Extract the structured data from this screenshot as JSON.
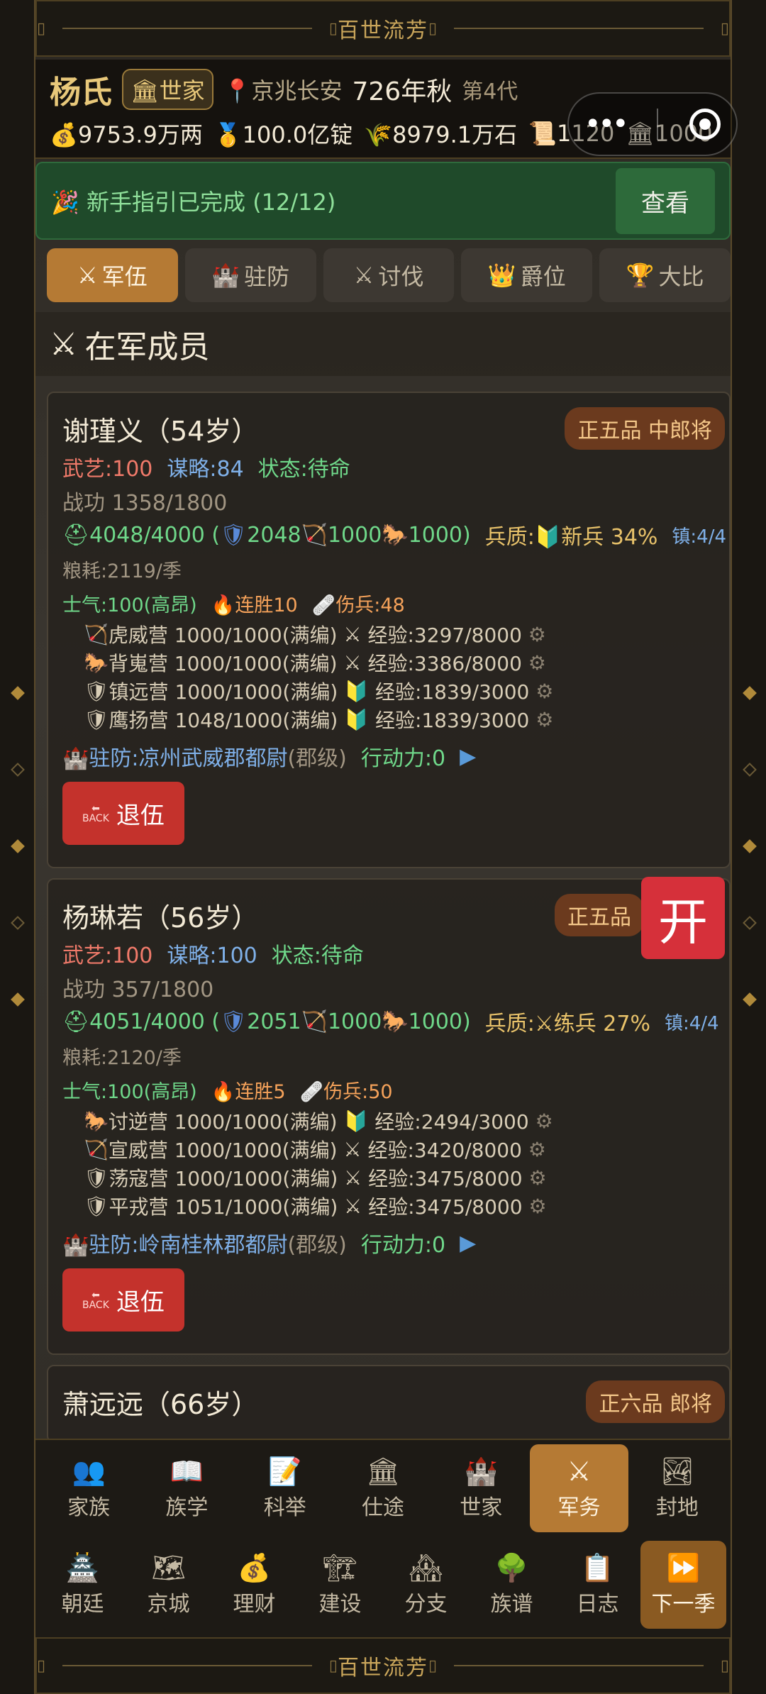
{
  "banner_text": "百世流芳",
  "header": {
    "clan": "杨氏",
    "status": "世家",
    "location": "京兆长安",
    "year": "726年秋",
    "generation": "第4代",
    "silver": "9753.9万两",
    "gold": "100.0亿锭",
    "grain": "8979.1万石",
    "fame": "1120",
    "prestige": "1000"
  },
  "guide": {
    "text": "新手指引已完成 (12/12)",
    "button": "查看"
  },
  "tabs": [
    "军伍",
    "驻防",
    "讨伐",
    "爵位",
    "大比"
  ],
  "section_title": "在军成员",
  "members": [
    {
      "name": "谢瑾义（54岁）",
      "rank": "正五品 中郎将",
      "martial": "武艺:100",
      "strategy": "谋略:84",
      "state": "状态:待命",
      "merit": "战功 1358/1800",
      "troops": "4048/4000 (",
      "t1": "2048",
      "t2": "1000",
      "t3": "1000)",
      "quality": "兵质:",
      "quality_val": "新兵 34%",
      "town": "镇:4/4",
      "food": "粮耗:2119/季",
      "morale": "士气:100(高昂)",
      "streak": "连胜10",
      "wounded": "伤兵:48",
      "battalions": [
        {
          "icon": "🏹",
          "text": "虎威营 1000/1000(满编)",
          "exp_icon": "⚔",
          "exp": "经验:3297/8000"
        },
        {
          "icon": "🐎",
          "text": "背嵬营 1000/1000(满编)",
          "exp_icon": "⚔",
          "exp": "经验:3386/8000"
        },
        {
          "icon": "🛡",
          "text": "镇远营 1000/1000(满编)",
          "exp_icon": "🔰",
          "exp": "经验:1839/3000"
        },
        {
          "icon": "🛡",
          "text": "鹰扬营 1048/1000(满编)",
          "exp_icon": "🔰",
          "exp": "经验:1839/3000"
        }
      ],
      "garrison": "驻防:凉州武威郡都尉",
      "level": "(郡级)",
      "action": "行动力:0",
      "retreat": "退伍"
    },
    {
      "name": "杨琳若（56岁）",
      "rank": "正五品",
      "martial": "武艺:100",
      "strategy": "谋略:100",
      "state": "状态:待命",
      "merit": "战功 357/1800",
      "troops": "4051/4000 (",
      "t1": "2051",
      "t2": "1000",
      "t3": "1000)",
      "quality": "兵质:",
      "quality_val": "练兵 27%",
      "town": "镇:4/4",
      "food": "粮耗:2120/季",
      "morale": "士气:100(高昂)",
      "streak": "连胜5",
      "wounded": "伤兵:50",
      "battalions": [
        {
          "icon": "🐎",
          "text": "讨逆营 1000/1000(满编)",
          "exp_icon": "🔰",
          "exp": "经验:2494/3000"
        },
        {
          "icon": "🏹",
          "text": "宣威营 1000/1000(满编)",
          "exp_icon": "⚔",
          "exp": "经验:3420/8000"
        },
        {
          "icon": "🛡",
          "text": "荡寇营 1000/1000(满编)",
          "exp_icon": "⚔",
          "exp": "经验:3475/8000"
        },
        {
          "icon": "🛡",
          "text": "平戎营 1051/1000(满编)",
          "exp_icon": "⚔",
          "exp": "经验:3475/8000"
        }
      ],
      "garrison": "驻防:岭南桂林郡都尉",
      "level": "(郡级)",
      "action": "行动力:0",
      "retreat": "退伍"
    },
    {
      "name": "萧远远（66岁）",
      "rank": "正六品 郎将"
    }
  ],
  "kai": "开",
  "nav_row1": [
    {
      "icon": "👥",
      "label": "家族"
    },
    {
      "icon": "📖",
      "label": "族学"
    },
    {
      "icon": "📝",
      "label": "科举"
    },
    {
      "icon": "🏛",
      "label": "仕途"
    },
    {
      "icon": "🏰",
      "label": "世家"
    },
    {
      "icon": "⚔",
      "label": "军务"
    },
    {
      "icon": "🏞",
      "label": "封地"
    }
  ],
  "nav_row2": [
    {
      "icon": "🏯",
      "label": "朝廷"
    },
    {
      "icon": "🗺",
      "label": "京城"
    },
    {
      "icon": "💰",
      "label": "理财"
    },
    {
      "icon": "🏗",
      "label": "建设"
    },
    {
      "icon": "🏘",
      "label": "分支"
    },
    {
      "icon": "🌳",
      "label": "族谱"
    },
    {
      "icon": "📋",
      "label": "日志"
    },
    {
      "icon": "⏩",
      "label": "下一季"
    }
  ]
}
